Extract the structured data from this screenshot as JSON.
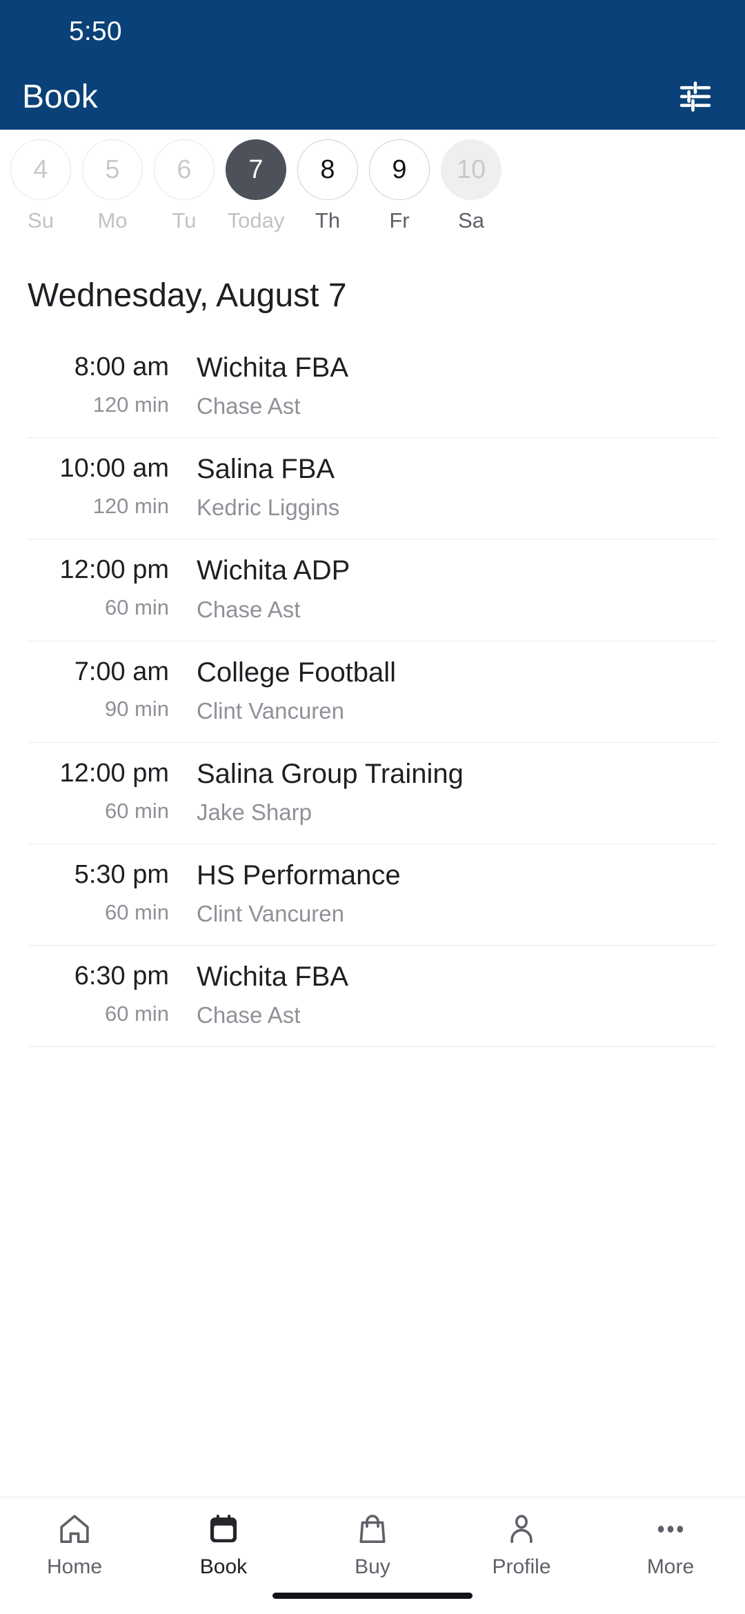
{
  "status_bar": {
    "time": "5:50"
  },
  "app_bar": {
    "title": "Book",
    "filter_icon": "tune-icon"
  },
  "colors": {
    "brand_blue": "#0a4178",
    "selected_day": "#4d5159",
    "text_primary": "#1d1f23",
    "text_muted": "#8e9197",
    "divider": "#eaeaea"
  },
  "date_strip": {
    "days": [
      {
        "number": "4",
        "label": "Su",
        "state": "past"
      },
      {
        "number": "5",
        "label": "Mo",
        "state": "past"
      },
      {
        "number": "6",
        "label": "Tu",
        "state": "past"
      },
      {
        "number": "7",
        "label": "Today",
        "state": "selected"
      },
      {
        "number": "8",
        "label": "Th",
        "state": "available"
      },
      {
        "number": "9",
        "label": "Fr",
        "state": "available"
      },
      {
        "number": "10",
        "label": "Sa",
        "state": "filled"
      }
    ]
  },
  "day_heading": "Wednesday, August 7",
  "appointments": [
    {
      "time": "8:00 am",
      "duration": "120 min",
      "title": "Wichita FBA",
      "instructor": "Chase Ast"
    },
    {
      "time": "10:00 am",
      "duration": "120 min",
      "title": "Salina FBA",
      "instructor": "Kedric Liggins"
    },
    {
      "time": "12:00 pm",
      "duration": "60 min",
      "title": "Wichita ADP",
      "instructor": "Chase Ast"
    },
    {
      "time": "7:00 am",
      "duration": "90 min",
      "title": "College Football",
      "instructor": "Clint Vancuren"
    },
    {
      "time": "12:00 pm",
      "duration": "60 min",
      "title": "Salina Group Training",
      "instructor": "Jake Sharp"
    },
    {
      "time": "5:30 pm",
      "duration": "60 min",
      "title": "HS Performance",
      "instructor": "Clint Vancuren"
    },
    {
      "time": "6:30 pm",
      "duration": "60 min",
      "title": "Wichita FBA",
      "instructor": "Chase Ast"
    }
  ],
  "bottom_nav": {
    "items": [
      {
        "label": "Home",
        "icon": "house-icon",
        "active": false
      },
      {
        "label": "Book",
        "icon": "calendar-icon",
        "active": true
      },
      {
        "label": "Buy",
        "icon": "bag-icon",
        "active": false
      },
      {
        "label": "Profile",
        "icon": "person-icon",
        "active": false
      },
      {
        "label": "More",
        "icon": "ellipsis-icon",
        "active": false
      }
    ]
  }
}
